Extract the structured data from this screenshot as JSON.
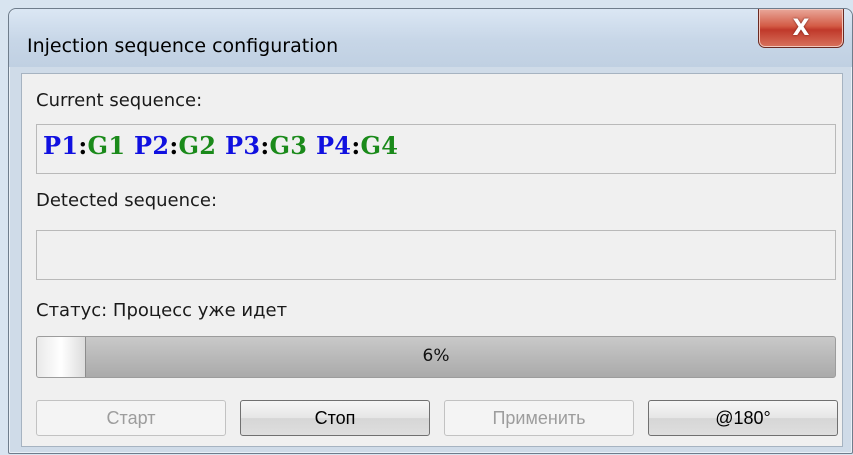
{
  "window": {
    "title": "Injection sequence configuration",
    "close_glyph": "X"
  },
  "current": {
    "label": "Current sequence:",
    "sequence": [
      {
        "p": "P1",
        "sep": ":",
        "g": "G1"
      },
      {
        "p": "P2",
        "sep": ":",
        "g": "G2"
      },
      {
        "p": "P3",
        "sep": ":",
        "g": "G3"
      },
      {
        "p": "P4",
        "sep": ":",
        "g": "G4"
      }
    ]
  },
  "detected": {
    "label": "Detected sequence:",
    "value": ""
  },
  "status": {
    "label": "Статус: Процесс уже идет"
  },
  "progress": {
    "percent": 6,
    "text": "6%"
  },
  "buttons": {
    "start": "Старт",
    "stop": "Стоп",
    "apply": "Применить",
    "angle": "@180°"
  },
  "colors": {
    "p_color": "#1010e0",
    "g_color": "#1a8a1a",
    "close_red": "#c0392a"
  }
}
